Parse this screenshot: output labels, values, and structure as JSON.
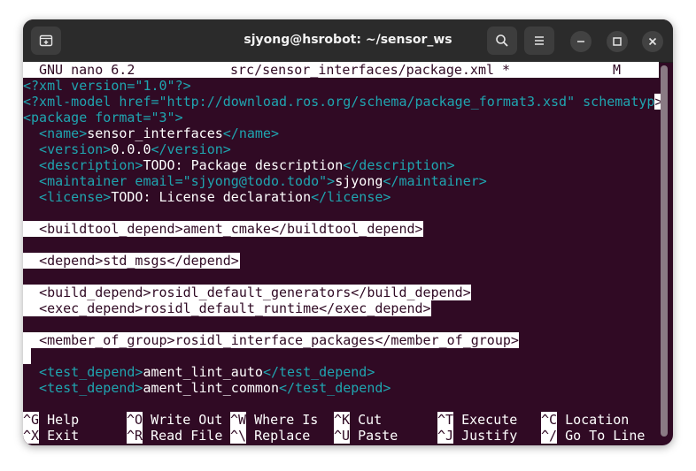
{
  "window": {
    "title": "sjyong@hsrobot: ~/sensor_ws",
    "icons": {
      "new_tab": "new-tab-icon",
      "search": "search-icon",
      "menu": "hamburger-menu-icon",
      "minimize": "minimize-icon",
      "maximize": "maximize-icon",
      "close": "close-icon"
    }
  },
  "nano": {
    "version": "GNU nano 6.2",
    "filename": "src/sensor_interfaces/package.xml *",
    "modified_flag": "M"
  },
  "file_lines": {
    "l1": "<?xml version=\"1.0\"?>",
    "l2_a": "<?xml-model href=\"http://download.ros.org/schema/package_format3.xsd\" schematyp",
    "l2_b": ">",
    "l3": "<package format=\"3\">",
    "l4_open": "  <name>",
    "l4_text": "sensor_interfaces",
    "l4_close": "</name>",
    "l5_open": "  <version>",
    "l5_text": "0.0.0",
    "l5_close": "</version>",
    "l6_open": "  <description>",
    "l6_text": "TODO: Package description",
    "l6_close": "</description>",
    "l7_open": "  <maintainer email=\"sjyong@todo.todo\">",
    "l7_text": "sjyong",
    "l7_close": "</maintainer>",
    "l8_open": "  <license>",
    "l8_text": "TODO: License declaration",
    "l8_close": "</license>",
    "l10": "<buildtool_depend>ament_cmake</buildtool_depend>",
    "l12": "<depend>std_msgs</depend>",
    "l14": "<build_depend>rosidl_default_generators</build_depend>",
    "l15": "<exec_depend>rosidl_default_runtime</exec_depend>",
    "l17": "<member_of_group>rosidl_interface_packages</member_of_group>",
    "l19_open": "  <test_depend>",
    "l19_text": "ament_lint_auto",
    "l19_close": "</test_depend>",
    "l20_open": "  <test_depend>",
    "l20_text": "ament_lint_common",
    "l20_close": "</test_depend>"
  },
  "shortcuts": [
    {
      "key": "^G",
      "label": "Help"
    },
    {
      "key": "^O",
      "label": "Write Out"
    },
    {
      "key": "^W",
      "label": "Where Is"
    },
    {
      "key": "^K",
      "label": "Cut"
    },
    {
      "key": "^T",
      "label": "Execute"
    },
    {
      "key": "^C",
      "label": "Location"
    },
    {
      "key": "^X",
      "label": "Exit"
    },
    {
      "key": "^R",
      "label": "Read File"
    },
    {
      "key": "^\\",
      "label": "Replace"
    },
    {
      "key": "^U",
      "label": "Paste"
    },
    {
      "key": "^J",
      "label": "Justify"
    },
    {
      "key": "^/",
      "label": "Go To Line"
    }
  ],
  "colors": {
    "terminal_bg": "#300a24",
    "tag": "#1fa5b0",
    "titlebar": "#2b2b2b"
  }
}
